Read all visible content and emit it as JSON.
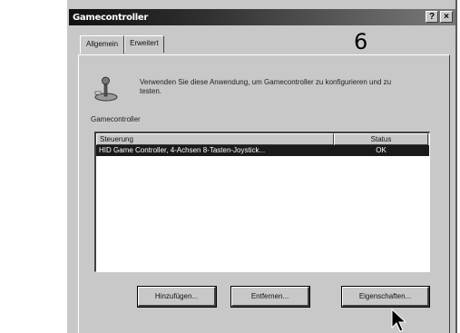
{
  "window": {
    "title": "Gamecontroller",
    "help_button": "?",
    "close_button": "×"
  },
  "tabs": [
    {
      "label": "Allgemein",
      "active": true
    },
    {
      "label": "Erweitert",
      "active": false
    }
  ],
  "step_number": "6",
  "description": "Verwenden Sie diese Anwendung, um Gamecontroller zu konfigurieren und zu testen.",
  "group": {
    "label": "Gamecontroller",
    "columns": [
      "Steuerung",
      "Status"
    ],
    "rows": [
      {
        "name": "HID Game Controller, 4-Achsen 8-Tasten-Joystick...",
        "status": "OK",
        "selected": true
      }
    ]
  },
  "buttons": {
    "add": "Hinzufügen...",
    "remove": "Entfernen...",
    "properties": "Eigenschaften..."
  },
  "colors": {
    "dialog_bg": "#c8c8c8",
    "selection": "#1a1a1a"
  }
}
